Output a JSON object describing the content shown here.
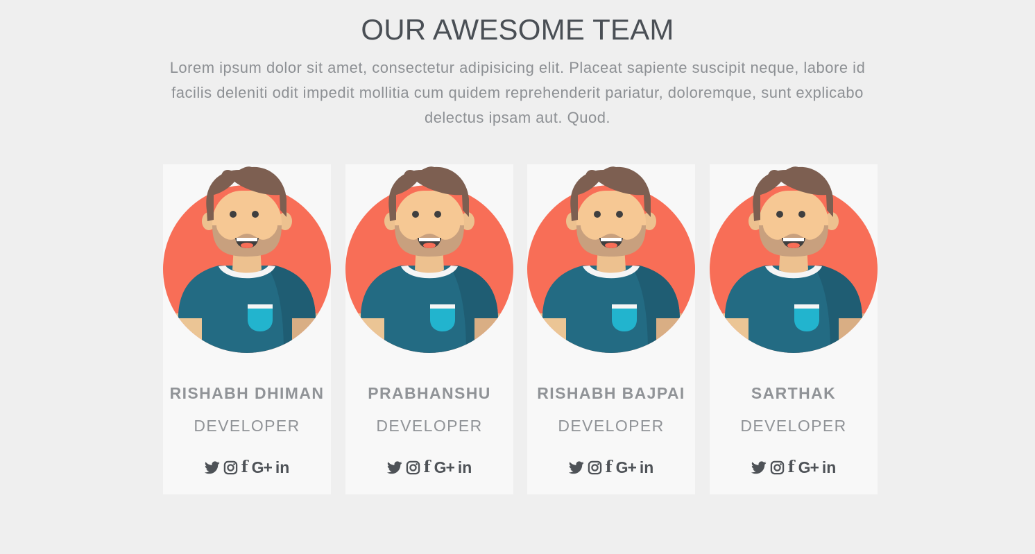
{
  "header": {
    "title": "OUR AWESOME TEAM",
    "intro": "Lorem ipsum dolor sit amet, consectetur adipisicing elit. Placeat sapiente suscipit neque, labore id facilis deleniti odit impedit mollitia cum quidem reprehenderit pariatur, doloremque, sunt explicabo delectus ipsam aut. Quod."
  },
  "team": [
    {
      "name": "RISHABH DHIMAN",
      "role": "DEVELOPER",
      "social": [
        "twitter-icon",
        "instagram-icon",
        "facebook-icon",
        "google-plus-icon",
        "linkedin-icon"
      ]
    },
    {
      "name": "PRABHANSHU",
      "role": "DEVELOPER",
      "social": [
        "twitter-icon",
        "instagram-icon",
        "facebook-icon",
        "google-plus-icon",
        "linkedin-icon"
      ]
    },
    {
      "name": "RISHABH BAJPAI",
      "role": "DEVELOPER",
      "social": [
        "twitter-icon",
        "instagram-icon",
        "facebook-icon",
        "google-plus-icon",
        "linkedin-icon"
      ]
    },
    {
      "name": "SARTHAK",
      "role": "DEVELOPER",
      "social": [
        "twitter-icon",
        "instagram-icon",
        "facebook-icon",
        "google-plus-icon",
        "linkedin-icon"
      ]
    }
  ],
  "social_glyphs": {
    "facebook": "f",
    "google_plus": "G+",
    "linkedin": "in"
  },
  "colors": {
    "background": "#efefef",
    "card": "#f8f8f8",
    "avatar_circle": "#f86e57",
    "shirt": "#236b83",
    "pocket": "#22b4ce",
    "hair": "#7d5f51",
    "skin": "#f6c894",
    "title_text": "#4a4f55",
    "muted_text": "#909397"
  }
}
